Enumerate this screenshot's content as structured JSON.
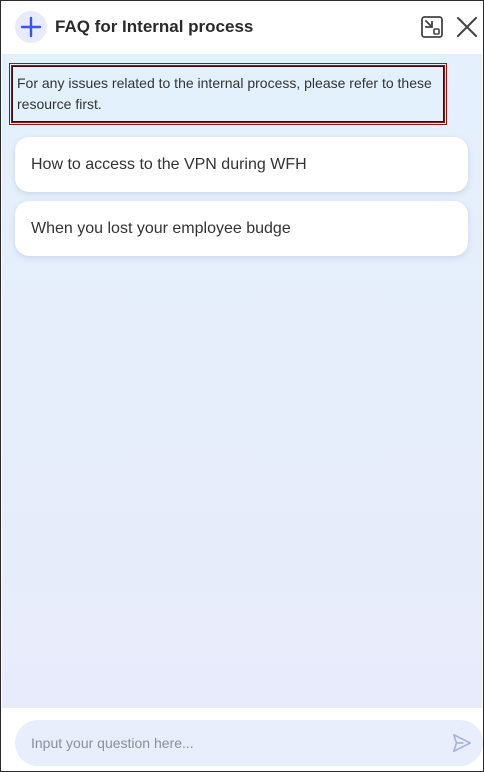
{
  "header": {
    "title": "FAQ for Internal process",
    "new_chat_icon": "plus-icon",
    "exit_window_icon": "exit-fullscreen-icon",
    "close_icon": "close-icon"
  },
  "notice": {
    "text": "For any issues related to the internal process, please refer to these resource first."
  },
  "faq_items": [
    {
      "label": "How to access to the VPN during WFH"
    },
    {
      "label": "When you lost your employee budge"
    }
  ],
  "composer": {
    "placeholder": "Input your question here...",
    "send_icon": "send-icon"
  },
  "colors": {
    "accent": "#3b55e6",
    "notice_border": "#8b1a1a"
  }
}
